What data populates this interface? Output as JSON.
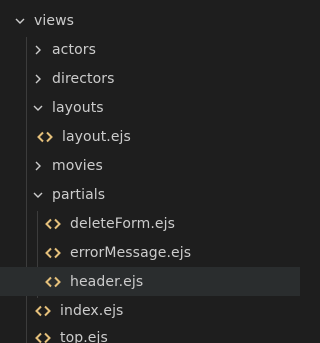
{
  "explorer": {
    "items": [
      {
        "label": "views",
        "kind": "folder",
        "expanded": true,
        "icon": "chevron-down-icon"
      },
      {
        "label": "actors",
        "kind": "folder",
        "expanded": false,
        "icon": "chevron-right-icon"
      },
      {
        "label": "directors",
        "kind": "folder",
        "expanded": false,
        "icon": "chevron-right-icon"
      },
      {
        "label": "layouts",
        "kind": "folder",
        "expanded": true,
        "icon": "chevron-down-icon"
      },
      {
        "label": "layout.ejs",
        "kind": "file",
        "icon": "code-brackets-icon"
      },
      {
        "label": "movies",
        "kind": "folder",
        "expanded": false,
        "icon": "chevron-right-icon"
      },
      {
        "label": "partials",
        "kind": "folder",
        "expanded": true,
        "icon": "chevron-down-icon"
      },
      {
        "label": "deleteForm.ejs",
        "kind": "file",
        "icon": "code-brackets-icon"
      },
      {
        "label": "errorMessage.ejs",
        "kind": "file",
        "icon": "code-brackets-icon"
      },
      {
        "label": "header.ejs",
        "kind": "file",
        "icon": "code-brackets-icon",
        "selected": true
      },
      {
        "label": "index.ejs",
        "kind": "file",
        "icon": "code-brackets-icon"
      },
      {
        "label": "top.ejs",
        "kind": "file",
        "icon": "code-brackets-icon"
      }
    ]
  },
  "colors": {
    "background": "#1e1e1e",
    "selected_row": "#2a2d2e",
    "text": "#cccccc",
    "ejs_icon": "#e5c07b",
    "indent_guide": "#3c3c3c"
  }
}
